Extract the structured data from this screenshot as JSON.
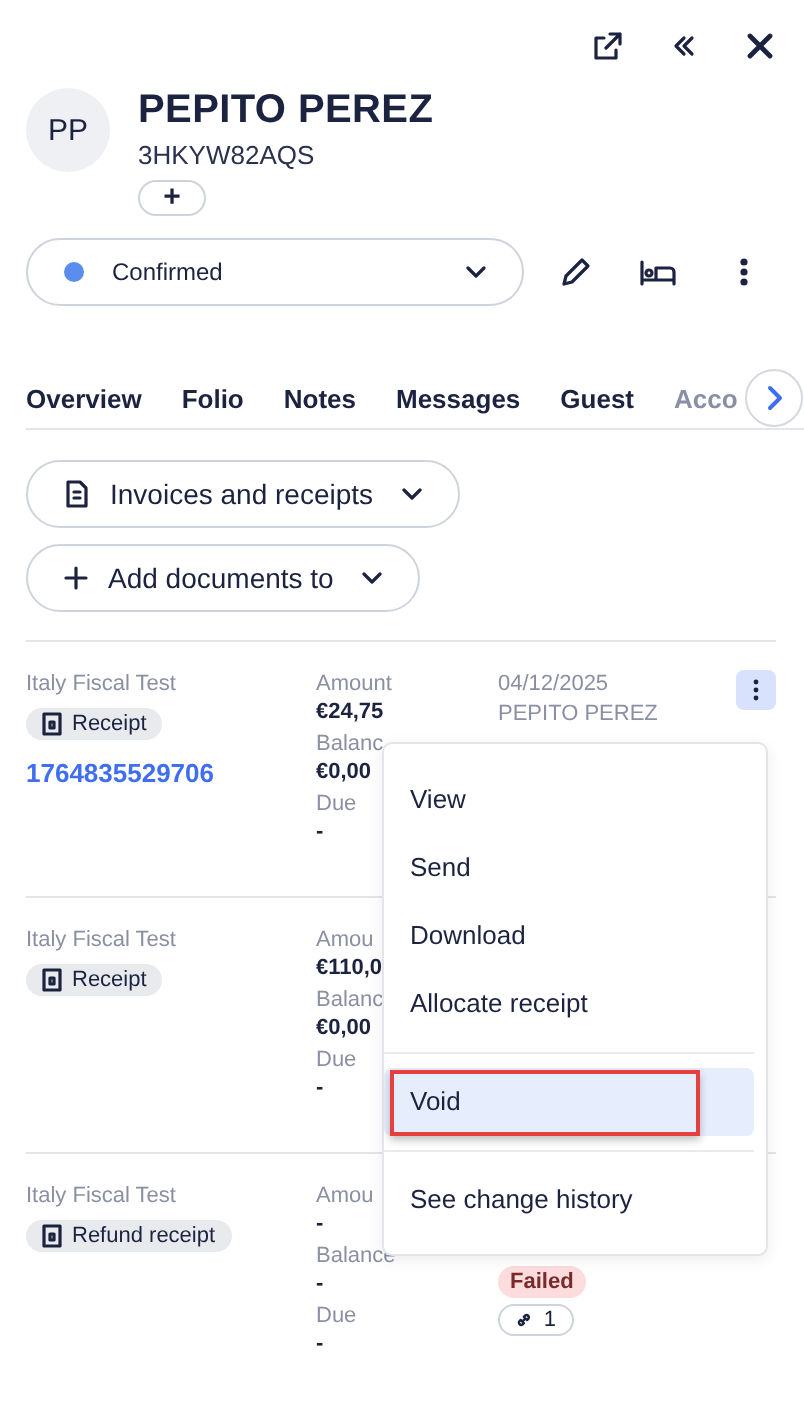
{
  "header": {
    "initials": "PP",
    "name": "PEPITO PEREZ",
    "code": "3HKYW82AQS",
    "add_label": "+"
  },
  "status": {
    "label": "Confirmed",
    "color": "#5b8def"
  },
  "tabs": [
    {
      "label": "Overview"
    },
    {
      "label": "Folio"
    },
    {
      "label": "Notes"
    },
    {
      "label": "Messages"
    },
    {
      "label": "Guest"
    },
    {
      "label": "Acco"
    }
  ],
  "actions": [
    {
      "kind": "doc",
      "label": "Invoices and receipts"
    },
    {
      "kind": "add",
      "label": "Add documents to"
    }
  ],
  "documents": [
    {
      "source": "Italy Fiscal Test",
      "type": "Receipt",
      "number": "1764835529706",
      "fields": [
        {
          "label": "Amount",
          "value": "€24,75"
        },
        {
          "label": "Balanc",
          "value": "€0,00"
        },
        {
          "label": "Due",
          "value": "-"
        }
      ],
      "date": "04/12/2025",
      "guest": "PEPITO PEREZ",
      "menu_open": true
    },
    {
      "source": "Italy Fiscal Test",
      "type": "Receipt",
      "fields": [
        {
          "label": "Amou",
          "value": "€110,0"
        },
        {
          "label": "Balanc",
          "value": "€0,00"
        },
        {
          "label": "Due",
          "value": "-"
        }
      ],
      "menu_open": false
    },
    {
      "source": "Italy Fiscal Test",
      "type": "Refund receipt",
      "fields": [
        {
          "label": "Amou",
          "value": "-"
        },
        {
          "label": "Balance",
          "value": "-"
        },
        {
          "label": "Due",
          "value": "-"
        }
      ],
      "status": "Failed",
      "links": "1",
      "menu_open": false
    }
  ],
  "menu": {
    "groups": [
      [
        {
          "label": "View",
          "selected": false
        },
        {
          "label": "Send",
          "selected": false
        },
        {
          "label": "Download",
          "selected": false
        },
        {
          "label": "Allocate receipt",
          "selected": false
        }
      ],
      [
        {
          "label": "Void",
          "selected": true,
          "annotated": true
        }
      ],
      [
        {
          "label": "See change history",
          "selected": false
        }
      ]
    ]
  }
}
